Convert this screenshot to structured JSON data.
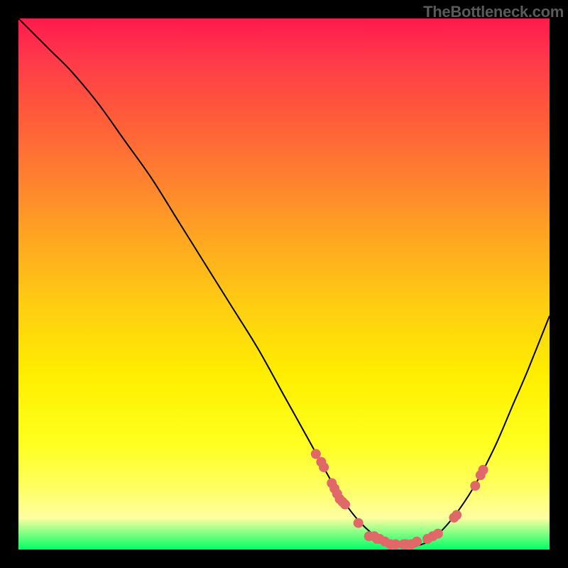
{
  "watermark": "TheBottleneck.com",
  "colors": {
    "background": "#000000",
    "curve": "#000000",
    "dots": "#e06868",
    "gradient_top": "#ff1a4d",
    "gradient_bottom": "#00ff66"
  },
  "chart_data": {
    "type": "line",
    "title": "",
    "xlabel": "",
    "ylabel": "",
    "xlim": [
      0,
      100
    ],
    "ylim": [
      0,
      100
    ],
    "series": [
      {
        "name": "bottleneck-curve",
        "x": [
          0,
          3,
          6,
          10,
          15,
          20,
          25,
          30,
          35,
          40,
          45,
          50,
          55,
          58,
          60,
          62,
          64,
          66,
          68,
          70,
          72,
          74,
          76,
          78,
          81,
          84,
          87,
          90,
          93,
          96,
          100
        ],
        "y": [
          100,
          97,
          94,
          90,
          84,
          77,
          70,
          62,
          54,
          46,
          38,
          29,
          20,
          14.5,
          11,
          8,
          5.5,
          3.5,
          2,
          1,
          0.5,
          0.5,
          1,
          2,
          5,
          9,
          14,
          20,
          27,
          34,
          44
        ]
      }
    ],
    "markers": [
      {
        "x": 56,
        "y": 18
      },
      {
        "x": 57,
        "y": 16.5
      },
      {
        "x": 57.5,
        "y": 15.5
      },
      {
        "x": 59,
        "y": 12.5
      },
      {
        "x": 59.5,
        "y": 11.5
      },
      {
        "x": 60,
        "y": 10.5
      },
      {
        "x": 60.5,
        "y": 9.5
      },
      {
        "x": 61,
        "y": 9
      },
      {
        "x": 61.5,
        "y": 8.5
      },
      {
        "x": 64,
        "y": 5
      },
      {
        "x": 66,
        "y": 2.5
      },
      {
        "x": 67,
        "y": 2.5
      },
      {
        "x": 67.5,
        "y": 2
      },
      {
        "x": 68,
        "y": 2
      },
      {
        "x": 69,
        "y": 1.5
      },
      {
        "x": 70,
        "y": 1
      },
      {
        "x": 71,
        "y": 1
      },
      {
        "x": 72.5,
        "y": 1
      },
      {
        "x": 73,
        "y": 1
      },
      {
        "x": 74,
        "y": 1
      },
      {
        "x": 75,
        "y": 1.5
      },
      {
        "x": 77,
        "y": 2
      },
      {
        "x": 78,
        "y": 2.5
      },
      {
        "x": 79,
        "y": 3
      },
      {
        "x": 82,
        "y": 6
      },
      {
        "x": 82.5,
        "y": 6.5
      },
      {
        "x": 86,
        "y": 12
      },
      {
        "x": 87,
        "y": 14
      },
      {
        "x": 87.5,
        "y": 15
      }
    ]
  }
}
